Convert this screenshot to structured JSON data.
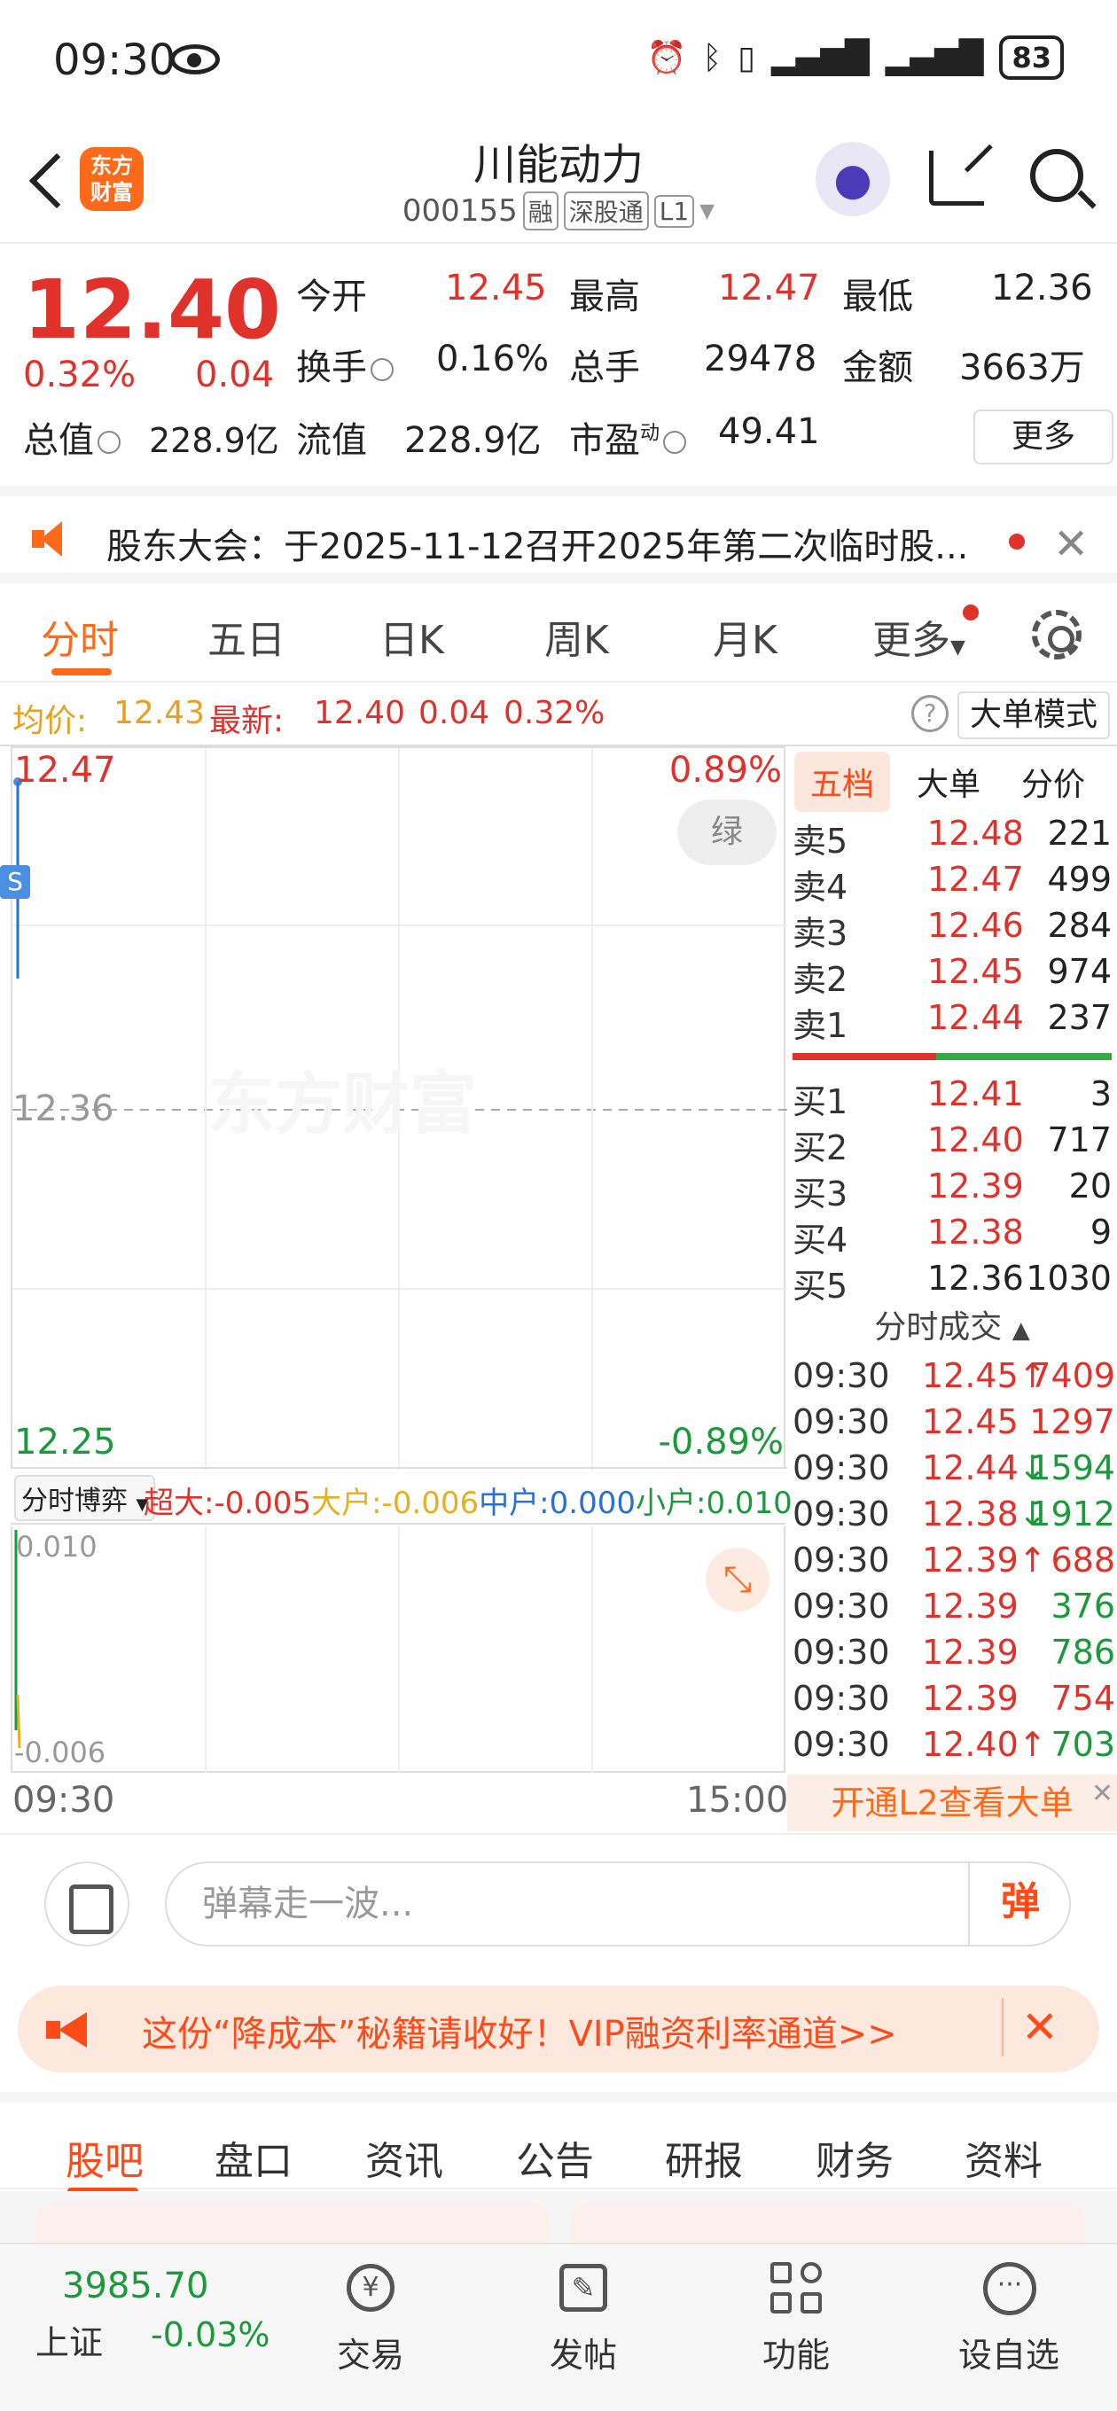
{
  "status": {
    "time": "09:30",
    "battery": "83"
  },
  "header": {
    "logo": "东方\n财富",
    "name": "川能动力",
    "code": "000155",
    "tags": [
      "融",
      "深股通",
      "L1"
    ]
  },
  "quote": {
    "price": "12.40",
    "pct": "0.32%",
    "change": "0.04",
    "open_label": "今开",
    "open": "12.45",
    "high_label": "最高",
    "high": "12.47",
    "low_label": "最低",
    "low": "12.36",
    "turnover_label": "换手",
    "turnover": "0.16%",
    "volume_label": "总手",
    "volume": "29478",
    "amount_label": "金额",
    "amount": "3663万",
    "mcap_label": "总值",
    "mcap": "228.9亿",
    "float_label": "流值",
    "float": "228.9亿",
    "pe_label": "市盈",
    "pe_sup": "动",
    "pe": "49.41",
    "more": "更多"
  },
  "notice": {
    "text": "股东大会：于2025-11-12召开2025年第二次临时股..."
  },
  "tabs": [
    "分时",
    "五日",
    "日K",
    "周K",
    "月K",
    "更多"
  ],
  "infobar": {
    "avg_label": "均价:",
    "avg": "12.43",
    "latest_label": "最新:",
    "latest": "12.40",
    "chg": "0.04",
    "pct": "0.32%",
    "big_mode": "大单模式"
  },
  "chart": {
    "y_top": "12.47",
    "y_mid": "12.36",
    "y_bot": "12.25",
    "pct_top": "0.89%",
    "pct_bot": "-0.89%",
    "green_btn": "绿",
    "watermark": "东方财富",
    "s_badge": "S",
    "sub_label": "分时博弈",
    "sub_legend": [
      {
        "name": "超大",
        "value": "-0.005",
        "color": "#e0312a"
      },
      {
        "name": "大户",
        "value": "-0.006",
        "color": "#e8b020"
      },
      {
        "name": "中户",
        "value": "0.000",
        "color": "#2a6fd6"
      },
      {
        "name": "小户",
        "value": "0.010",
        "color": "#1a9a3a"
      }
    ],
    "sub_top": "0.010",
    "sub_bot": "-0.006",
    "x_start": "09:30",
    "x_end": "15:00"
  },
  "order_book": {
    "tabs": [
      "五档",
      "大单",
      "分价"
    ],
    "asks": [
      {
        "label": "卖5",
        "price": "12.48",
        "vol": "221"
      },
      {
        "label": "卖4",
        "price": "12.47",
        "vol": "499"
      },
      {
        "label": "卖3",
        "price": "12.46",
        "vol": "284"
      },
      {
        "label": "卖2",
        "price": "12.45",
        "vol": "974"
      },
      {
        "label": "卖1",
        "price": "12.44",
        "vol": "237"
      }
    ],
    "bids": [
      {
        "label": "买1",
        "price": "12.41",
        "vol": "3",
        "color": "#e0312a"
      },
      {
        "label": "买2",
        "price": "12.40",
        "vol": "717",
        "color": "#e0312a"
      },
      {
        "label": "买3",
        "price": "12.39",
        "vol": "20",
        "color": "#e0312a"
      },
      {
        "label": "买4",
        "price": "12.38",
        "vol": "9",
        "color": "#e0312a"
      },
      {
        "label": "买5",
        "price": "12.36",
        "vol": "1030",
        "color": "#222"
      }
    ],
    "ticks_title": "分时成交",
    "ticks": [
      {
        "t": "09:30",
        "p": "12.45",
        "arrow": "↑",
        "v": "7409",
        "vcolor": "#e0312a"
      },
      {
        "t": "09:30",
        "p": "12.45",
        "arrow": "",
        "v": "1297",
        "vcolor": "#e0312a"
      },
      {
        "t": "09:30",
        "p": "12.44",
        "arrow": "↓",
        "v": "1594",
        "vcolor": "#1a9a3a"
      },
      {
        "t": "09:30",
        "p": "12.38",
        "arrow": "↓",
        "v": "1912",
        "vcolor": "#1a9a3a"
      },
      {
        "t": "09:30",
        "p": "12.39",
        "arrow": "↑",
        "v": "688",
        "vcolor": "#e0312a"
      },
      {
        "t": "09:30",
        "p": "12.39",
        "arrow": "",
        "v": "376",
        "vcolor": "#1a9a3a"
      },
      {
        "t": "09:30",
        "p": "12.39",
        "arrow": "",
        "v": "786",
        "vcolor": "#1a9a3a"
      },
      {
        "t": "09:30",
        "p": "12.39",
        "arrow": "",
        "v": "754",
        "vcolor": "#e0312a"
      },
      {
        "t": "09:30",
        "p": "12.40",
        "arrow": "↑",
        "v": "703",
        "vcolor": "#1a9a3a"
      }
    ],
    "l2_text": "开通L2查看大单"
  },
  "comment": {
    "placeholder": "弹幕走一波...",
    "send": "弹"
  },
  "promo": {
    "text": "这份“降成本”秘籍请收好！VIP融资利率通道>>"
  },
  "bottom_tabs": [
    "股吧",
    "盘口",
    "资讯",
    "公告",
    "研报",
    "财务",
    "资料"
  ],
  "nav": {
    "index_value": "3985.70",
    "index_name": "上证",
    "index_chg": "-0.03%",
    "items": [
      "交易",
      "发帖",
      "功能",
      "设自选"
    ]
  }
}
